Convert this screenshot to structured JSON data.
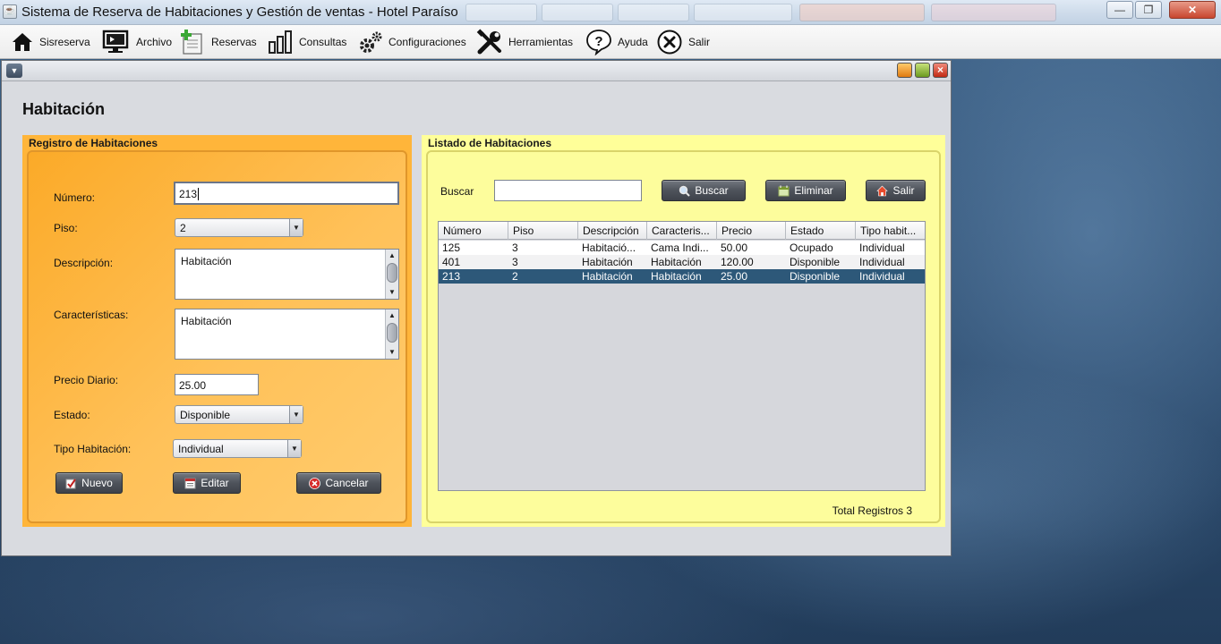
{
  "window": {
    "title": "Sistema de Reserva de Habitaciones y Gestión de ventas - Hotel Paraíso",
    "minimize": "—",
    "restore": "❐",
    "close": "✕"
  },
  "menu": [
    {
      "label": "Sisreserva",
      "icon": "home-icon"
    },
    {
      "label": "Archivo",
      "icon": "monitor-icon"
    },
    {
      "label": "Reservas",
      "icon": "document-add-icon"
    },
    {
      "label": "Consultas",
      "icon": "bar-chart-icon"
    },
    {
      "label": "Configuraciones",
      "icon": "gears-icon"
    },
    {
      "label": "Herramientas",
      "icon": "tools-icon"
    },
    {
      "label": "Ayuda",
      "icon": "help-icon"
    },
    {
      "label": "Salir",
      "icon": "close-circle-icon"
    }
  ],
  "form": {
    "heading": "Habitación",
    "panel_title": "Registro de Habitaciones",
    "numero": {
      "label": "Número:",
      "value": "213"
    },
    "piso": {
      "label": "Piso:",
      "value": "2"
    },
    "descripcion": {
      "label": "Descripción:",
      "value": "Habitación"
    },
    "caracteristicas": {
      "label": "Características:",
      "value": "Habitación"
    },
    "precio": {
      "label": "Precio Diario:",
      "value": "25.00"
    },
    "estado": {
      "label": "Estado:",
      "value": "Disponible"
    },
    "tipo": {
      "label": "Tipo Habitación:",
      "value": "Individual"
    },
    "buttons": {
      "nuevo": "Nuevo",
      "editar": "Editar",
      "cancelar": "Cancelar"
    }
  },
  "list": {
    "panel_title": "Listado de Habitaciones",
    "search_label": "Buscar",
    "search_value": "",
    "buttons": {
      "buscar": "Buscar",
      "eliminar": "Eliminar",
      "salir": "Salir"
    },
    "columns": [
      "Número",
      "Piso",
      "Descripción",
      "Caracteris...",
      "Precio",
      "Estado",
      "Tipo habit..."
    ],
    "rows": [
      [
        "125",
        "3",
        "Habitació...",
        "Cama Indi...",
        "50.00",
        "Ocupado",
        "Individual"
      ],
      [
        "401",
        "3",
        "Habitación",
        "Habitación",
        "120.00",
        "Disponible",
        "Individual"
      ],
      [
        "213",
        "2",
        "Habitación",
        "Habitación",
        "25.00",
        "Disponible",
        "Individual"
      ]
    ],
    "selected_row": 2,
    "total": "Total Registros 3"
  },
  "colors": {
    "registro_panel": "#ffb53a",
    "listado_panel": "#ffff99",
    "selected_row": "#2d5879",
    "button": "#4e535b"
  }
}
